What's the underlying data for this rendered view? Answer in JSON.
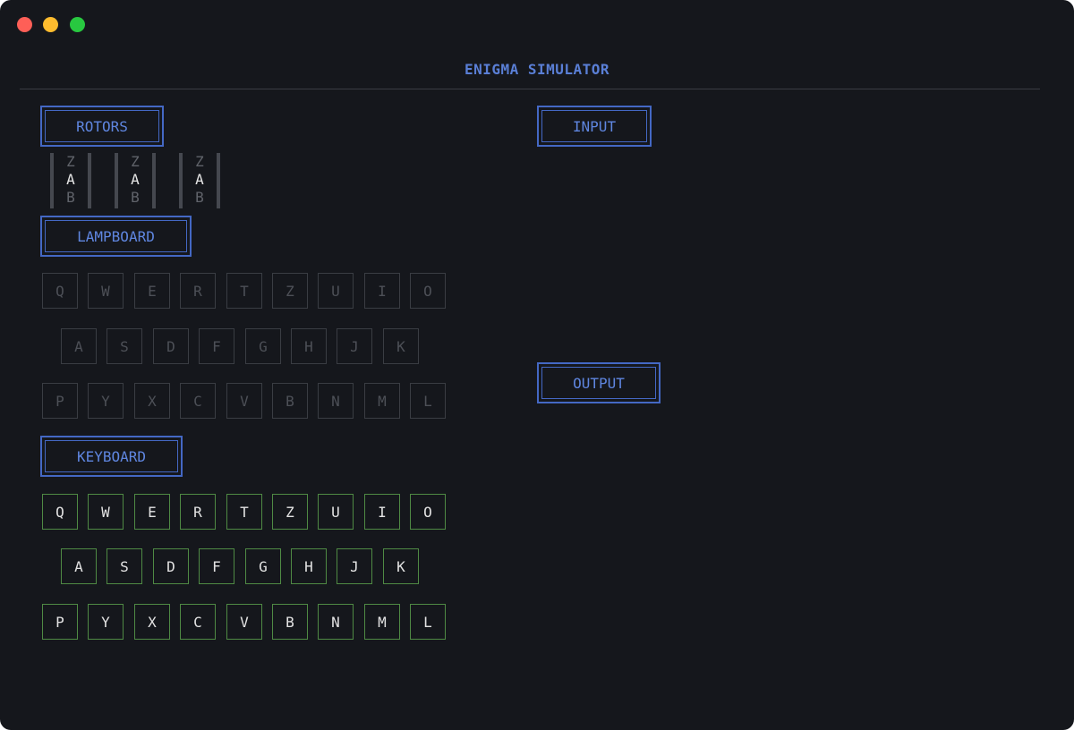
{
  "app": {
    "title": "ENIGMA SIMULATOR"
  },
  "sections": {
    "rotors": "ROTORS",
    "lampboard": "LAMPBOARD",
    "keyboard": "KEYBOARD",
    "input": "INPUT",
    "output": "OUTPUT"
  },
  "rotors": [
    {
      "prev": "Z",
      "current": "A",
      "next": "B"
    },
    {
      "prev": "Z",
      "current": "A",
      "next": "B"
    },
    {
      "prev": "Z",
      "current": "A",
      "next": "B"
    }
  ],
  "lampboard": {
    "rows": [
      [
        "Q",
        "W",
        "E",
        "R",
        "T",
        "Z",
        "U",
        "I",
        "O"
      ],
      [
        "A",
        "S",
        "D",
        "F",
        "G",
        "H",
        "J",
        "K"
      ],
      [
        "P",
        "Y",
        "X",
        "C",
        "V",
        "B",
        "N",
        "M",
        "L"
      ]
    ]
  },
  "keyboard": {
    "rows": [
      [
        "Q",
        "W",
        "E",
        "R",
        "T",
        "Z",
        "U",
        "I",
        "O"
      ],
      [
        "A",
        "S",
        "D",
        "F",
        "G",
        "H",
        "J",
        "K"
      ],
      [
        "P",
        "Y",
        "X",
        "C",
        "V",
        "B",
        "N",
        "M",
        "L"
      ]
    ]
  },
  "colors": {
    "accent": "#5f86e0",
    "lamp_off": "#4d5057",
    "key_border": "#4f8a44"
  }
}
